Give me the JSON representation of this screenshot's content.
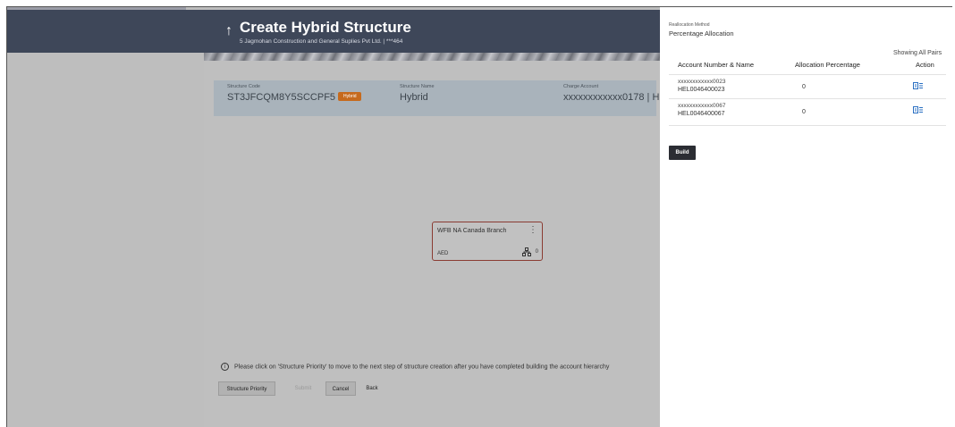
{
  "header": {
    "back_icon": "up-arrow-icon",
    "title": "Create Hybrid Structure",
    "subtitle": "5 Jagmohan Construction and General Suplies Pvt Ltd. | ***464"
  },
  "structure": {
    "code_label": "Structure Code",
    "code": "ST3JFCQM8Y5SCCPF5",
    "badge": "Hybrid",
    "name_label": "Structure Name",
    "name": "Hybrid",
    "charge_label": "Charge Account",
    "charge": "xxxxxxxxxxxx0178 | HE"
  },
  "node": {
    "name": "WFB NA Canada Branch",
    "currency": "AED",
    "count": "0",
    "menu_icon": "kebab-menu-icon",
    "tree_icon": "hierarchy-icon"
  },
  "note": "Please click on 'Structure Priority' to move to the next step of structure creation after you have completed building the account hierarchy",
  "buttons": {
    "structure_priority": "Structure Priority",
    "submit": "Submit",
    "cancel": "Cancel",
    "back": "Back"
  },
  "panel": {
    "method_label": "Reallocation Method",
    "method_value": "Percentage Allocation",
    "showing": "Showing All Pairs",
    "columns": [
      "Account Number & Name",
      "Allocation Percentage",
      "Action"
    ],
    "rows": [
      {
        "account": "xxxxxxxxxxxx0023",
        "name": "HEL0046400023",
        "percentage": "0",
        "action_icon": "edit-icon"
      },
      {
        "account": "xxxxxxxxxxxx0067",
        "name": "HEL0046400067",
        "percentage": "0",
        "action_icon": "edit-icon"
      }
    ],
    "build": "Build"
  }
}
